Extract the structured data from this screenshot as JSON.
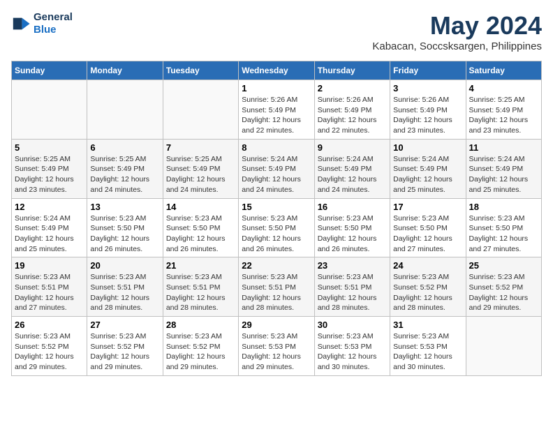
{
  "logo": {
    "line1": "General",
    "line2": "Blue"
  },
  "title": "May 2024",
  "subtitle": "Kabacan, Soccsksargen, Philippines",
  "headers": [
    "Sunday",
    "Monday",
    "Tuesday",
    "Wednesday",
    "Thursday",
    "Friday",
    "Saturday"
  ],
  "weeks": [
    [
      {
        "day": "",
        "info": ""
      },
      {
        "day": "",
        "info": ""
      },
      {
        "day": "",
        "info": ""
      },
      {
        "day": "1",
        "info": "Sunrise: 5:26 AM\nSunset: 5:49 PM\nDaylight: 12 hours\nand 22 minutes."
      },
      {
        "day": "2",
        "info": "Sunrise: 5:26 AM\nSunset: 5:49 PM\nDaylight: 12 hours\nand 22 minutes."
      },
      {
        "day": "3",
        "info": "Sunrise: 5:26 AM\nSunset: 5:49 PM\nDaylight: 12 hours\nand 23 minutes."
      },
      {
        "day": "4",
        "info": "Sunrise: 5:25 AM\nSunset: 5:49 PM\nDaylight: 12 hours\nand 23 minutes."
      }
    ],
    [
      {
        "day": "5",
        "info": "Sunrise: 5:25 AM\nSunset: 5:49 PM\nDaylight: 12 hours\nand 23 minutes."
      },
      {
        "day": "6",
        "info": "Sunrise: 5:25 AM\nSunset: 5:49 PM\nDaylight: 12 hours\nand 24 minutes."
      },
      {
        "day": "7",
        "info": "Sunrise: 5:25 AM\nSunset: 5:49 PM\nDaylight: 12 hours\nand 24 minutes."
      },
      {
        "day": "8",
        "info": "Sunrise: 5:24 AM\nSunset: 5:49 PM\nDaylight: 12 hours\nand 24 minutes."
      },
      {
        "day": "9",
        "info": "Sunrise: 5:24 AM\nSunset: 5:49 PM\nDaylight: 12 hours\nand 24 minutes."
      },
      {
        "day": "10",
        "info": "Sunrise: 5:24 AM\nSunset: 5:49 PM\nDaylight: 12 hours\nand 25 minutes."
      },
      {
        "day": "11",
        "info": "Sunrise: 5:24 AM\nSunset: 5:49 PM\nDaylight: 12 hours\nand 25 minutes."
      }
    ],
    [
      {
        "day": "12",
        "info": "Sunrise: 5:24 AM\nSunset: 5:49 PM\nDaylight: 12 hours\nand 25 minutes."
      },
      {
        "day": "13",
        "info": "Sunrise: 5:23 AM\nSunset: 5:50 PM\nDaylight: 12 hours\nand 26 minutes."
      },
      {
        "day": "14",
        "info": "Sunrise: 5:23 AM\nSunset: 5:50 PM\nDaylight: 12 hours\nand 26 minutes."
      },
      {
        "day": "15",
        "info": "Sunrise: 5:23 AM\nSunset: 5:50 PM\nDaylight: 12 hours\nand 26 minutes."
      },
      {
        "day": "16",
        "info": "Sunrise: 5:23 AM\nSunset: 5:50 PM\nDaylight: 12 hours\nand 26 minutes."
      },
      {
        "day": "17",
        "info": "Sunrise: 5:23 AM\nSunset: 5:50 PM\nDaylight: 12 hours\nand 27 minutes."
      },
      {
        "day": "18",
        "info": "Sunrise: 5:23 AM\nSunset: 5:50 PM\nDaylight: 12 hours\nand 27 minutes."
      }
    ],
    [
      {
        "day": "19",
        "info": "Sunrise: 5:23 AM\nSunset: 5:51 PM\nDaylight: 12 hours\nand 27 minutes."
      },
      {
        "day": "20",
        "info": "Sunrise: 5:23 AM\nSunset: 5:51 PM\nDaylight: 12 hours\nand 28 minutes."
      },
      {
        "day": "21",
        "info": "Sunrise: 5:23 AM\nSunset: 5:51 PM\nDaylight: 12 hours\nand 28 minutes."
      },
      {
        "day": "22",
        "info": "Sunrise: 5:23 AM\nSunset: 5:51 PM\nDaylight: 12 hours\nand 28 minutes."
      },
      {
        "day": "23",
        "info": "Sunrise: 5:23 AM\nSunset: 5:51 PM\nDaylight: 12 hours\nand 28 minutes."
      },
      {
        "day": "24",
        "info": "Sunrise: 5:23 AM\nSunset: 5:52 PM\nDaylight: 12 hours\nand 28 minutes."
      },
      {
        "day": "25",
        "info": "Sunrise: 5:23 AM\nSunset: 5:52 PM\nDaylight: 12 hours\nand 29 minutes."
      }
    ],
    [
      {
        "day": "26",
        "info": "Sunrise: 5:23 AM\nSunset: 5:52 PM\nDaylight: 12 hours\nand 29 minutes."
      },
      {
        "day": "27",
        "info": "Sunrise: 5:23 AM\nSunset: 5:52 PM\nDaylight: 12 hours\nand 29 minutes."
      },
      {
        "day": "28",
        "info": "Sunrise: 5:23 AM\nSunset: 5:52 PM\nDaylight: 12 hours\nand 29 minutes."
      },
      {
        "day": "29",
        "info": "Sunrise: 5:23 AM\nSunset: 5:53 PM\nDaylight: 12 hours\nand 29 minutes."
      },
      {
        "day": "30",
        "info": "Sunrise: 5:23 AM\nSunset: 5:53 PM\nDaylight: 12 hours\nand 30 minutes."
      },
      {
        "day": "31",
        "info": "Sunrise: 5:23 AM\nSunset: 5:53 PM\nDaylight: 12 hours\nand 30 minutes."
      },
      {
        "day": "",
        "info": ""
      }
    ]
  ]
}
